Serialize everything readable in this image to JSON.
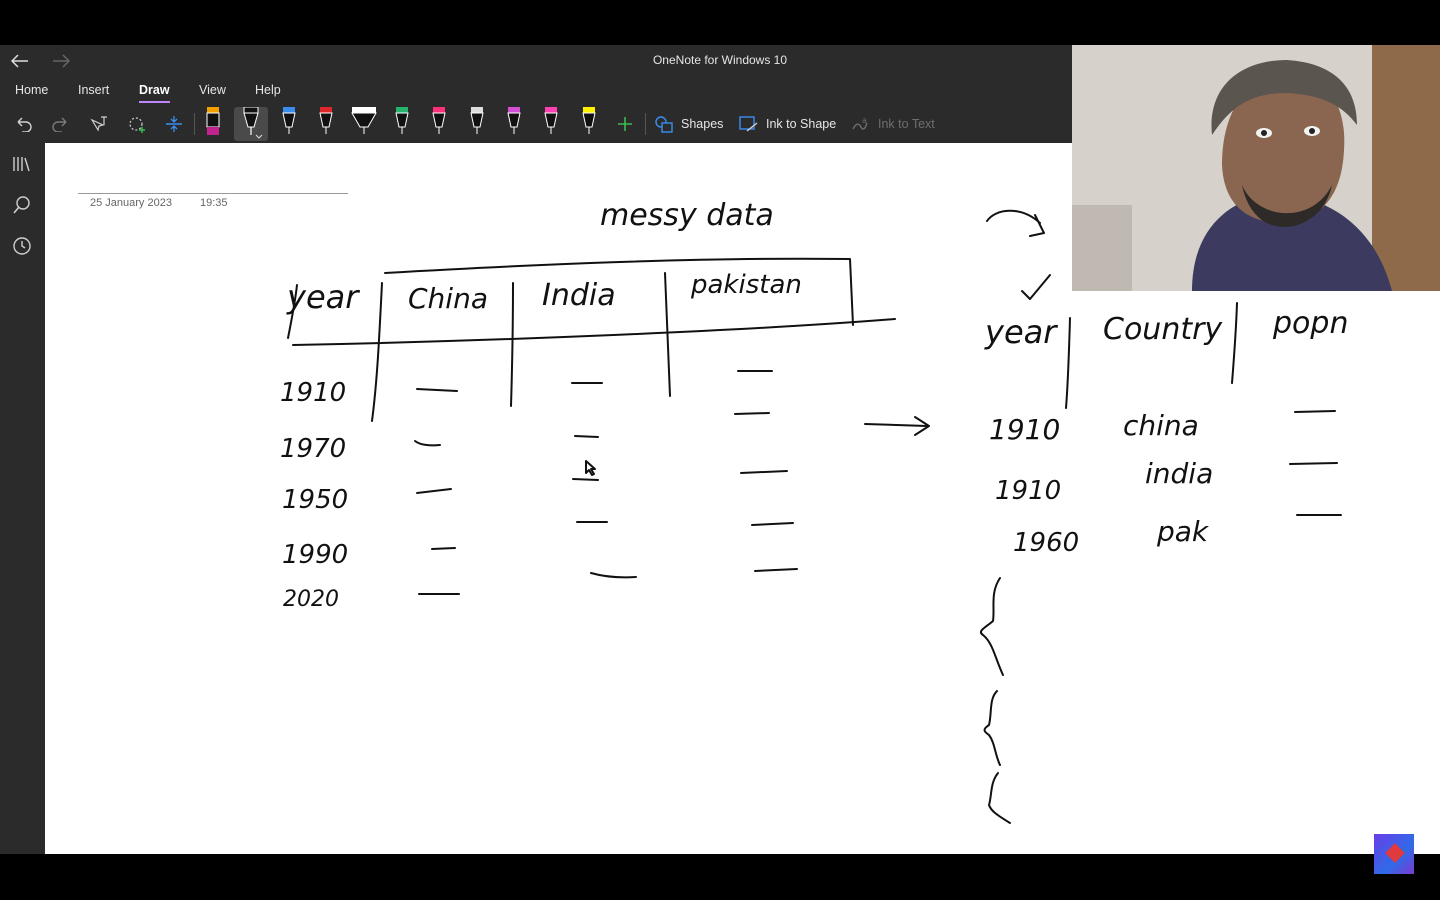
{
  "window": {
    "title": "OneNote for Windows 10",
    "back_icon": "arrow-left-icon",
    "forward_icon": "arrow-right-icon"
  },
  "menu": {
    "tabs": [
      "Home",
      "Insert",
      "Draw",
      "View",
      "Help"
    ],
    "active": "Draw"
  },
  "toolbar": {
    "shapes_label": "Shapes",
    "ink_to_shape_label": "Ink to Shape",
    "ink_to_text_label": "Ink to Text",
    "pen_colors": [
      "#f4a100",
      "#111111",
      "#3a8df0",
      "#e0262d",
      "#ffffff",
      "#26b36b",
      "#ff2f7a",
      "#dddddd",
      "#d24fd6",
      "#ff3fb5",
      "#fff200"
    ],
    "add_pen_color": "#3dbb4e"
  },
  "page": {
    "date": "25 January 2023",
    "time": "19:35"
  },
  "ink": {
    "title": "messy data",
    "left_table": {
      "headers": [
        "year",
        "China",
        "India",
        "pakistan"
      ],
      "years": [
        "1910",
        "1970",
        "1950",
        "1990",
        "2020"
      ]
    },
    "right_table": {
      "headers": [
        "year",
        "Country",
        "popn"
      ],
      "rows": [
        {
          "year": "1910",
          "country": "china"
        },
        {
          "year": "1910",
          "country": "india"
        },
        {
          "year": "1960",
          "country": "pak"
        }
      ]
    }
  }
}
